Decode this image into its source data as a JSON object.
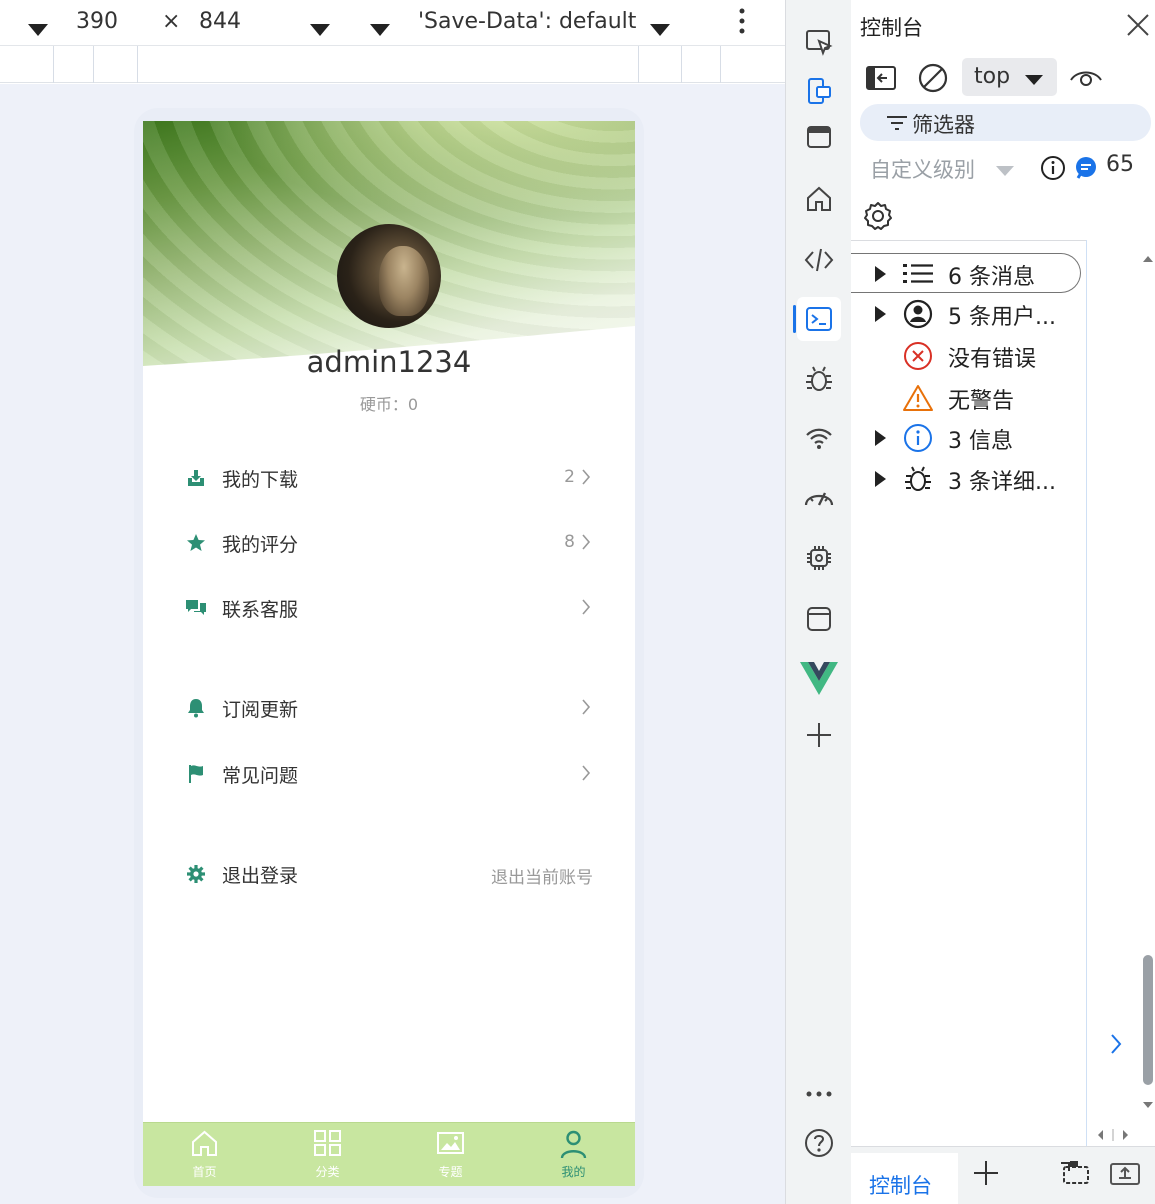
{
  "device_toolbar": {
    "width": "390",
    "times": "×",
    "height": "844",
    "save_data": "'Save-Data': default"
  },
  "app": {
    "username": "admin1234",
    "coins": "硬币：0",
    "menu": [
      {
        "label": "我的下载",
        "value": "2",
        "icon": "download-icon"
      },
      {
        "label": "我的评分",
        "value": "8",
        "icon": "star-icon"
      },
      {
        "label": "联系客服",
        "value": "",
        "icon": "chat-icon"
      },
      {
        "label": "订阅更新",
        "value": "",
        "icon": "bell-icon"
      },
      {
        "label": "常见问题",
        "value": "",
        "icon": "flag-icon"
      },
      {
        "label": "退出登录",
        "value": "退出当前账号",
        "icon": "gear-icon"
      }
    ],
    "tabs": [
      {
        "label": "首页",
        "icon": "home-icon"
      },
      {
        "label": "分类",
        "icon": "grid-icon"
      },
      {
        "label": "专题",
        "icon": "image-icon"
      },
      {
        "label": "我的",
        "icon": "user-icon",
        "active": true
      }
    ],
    "colors": {
      "accent": "#2d8f74",
      "tabbar": "#c8e6a0"
    }
  },
  "devtools": {
    "panel_title": "控制台",
    "context": "top",
    "filter_placeholder": "筛选器",
    "level": "自定义级别",
    "message_count": "65",
    "categories": [
      {
        "label": "6 条消息",
        "icon": "list-icon",
        "expandable": true
      },
      {
        "label": "5 条用户...",
        "icon": "user-circle-icon",
        "expandable": true
      },
      {
        "label": "没有错误",
        "icon": "error-icon",
        "expandable": false
      },
      {
        "label": "无警告",
        "icon": "warning-icon",
        "expandable": false
      },
      {
        "label": "3 信息",
        "icon": "info-icon",
        "expandable": true
      },
      {
        "label": "3 条详细...",
        "icon": "bug-icon",
        "expandable": true
      }
    ],
    "bottom_tab": "控制台"
  }
}
